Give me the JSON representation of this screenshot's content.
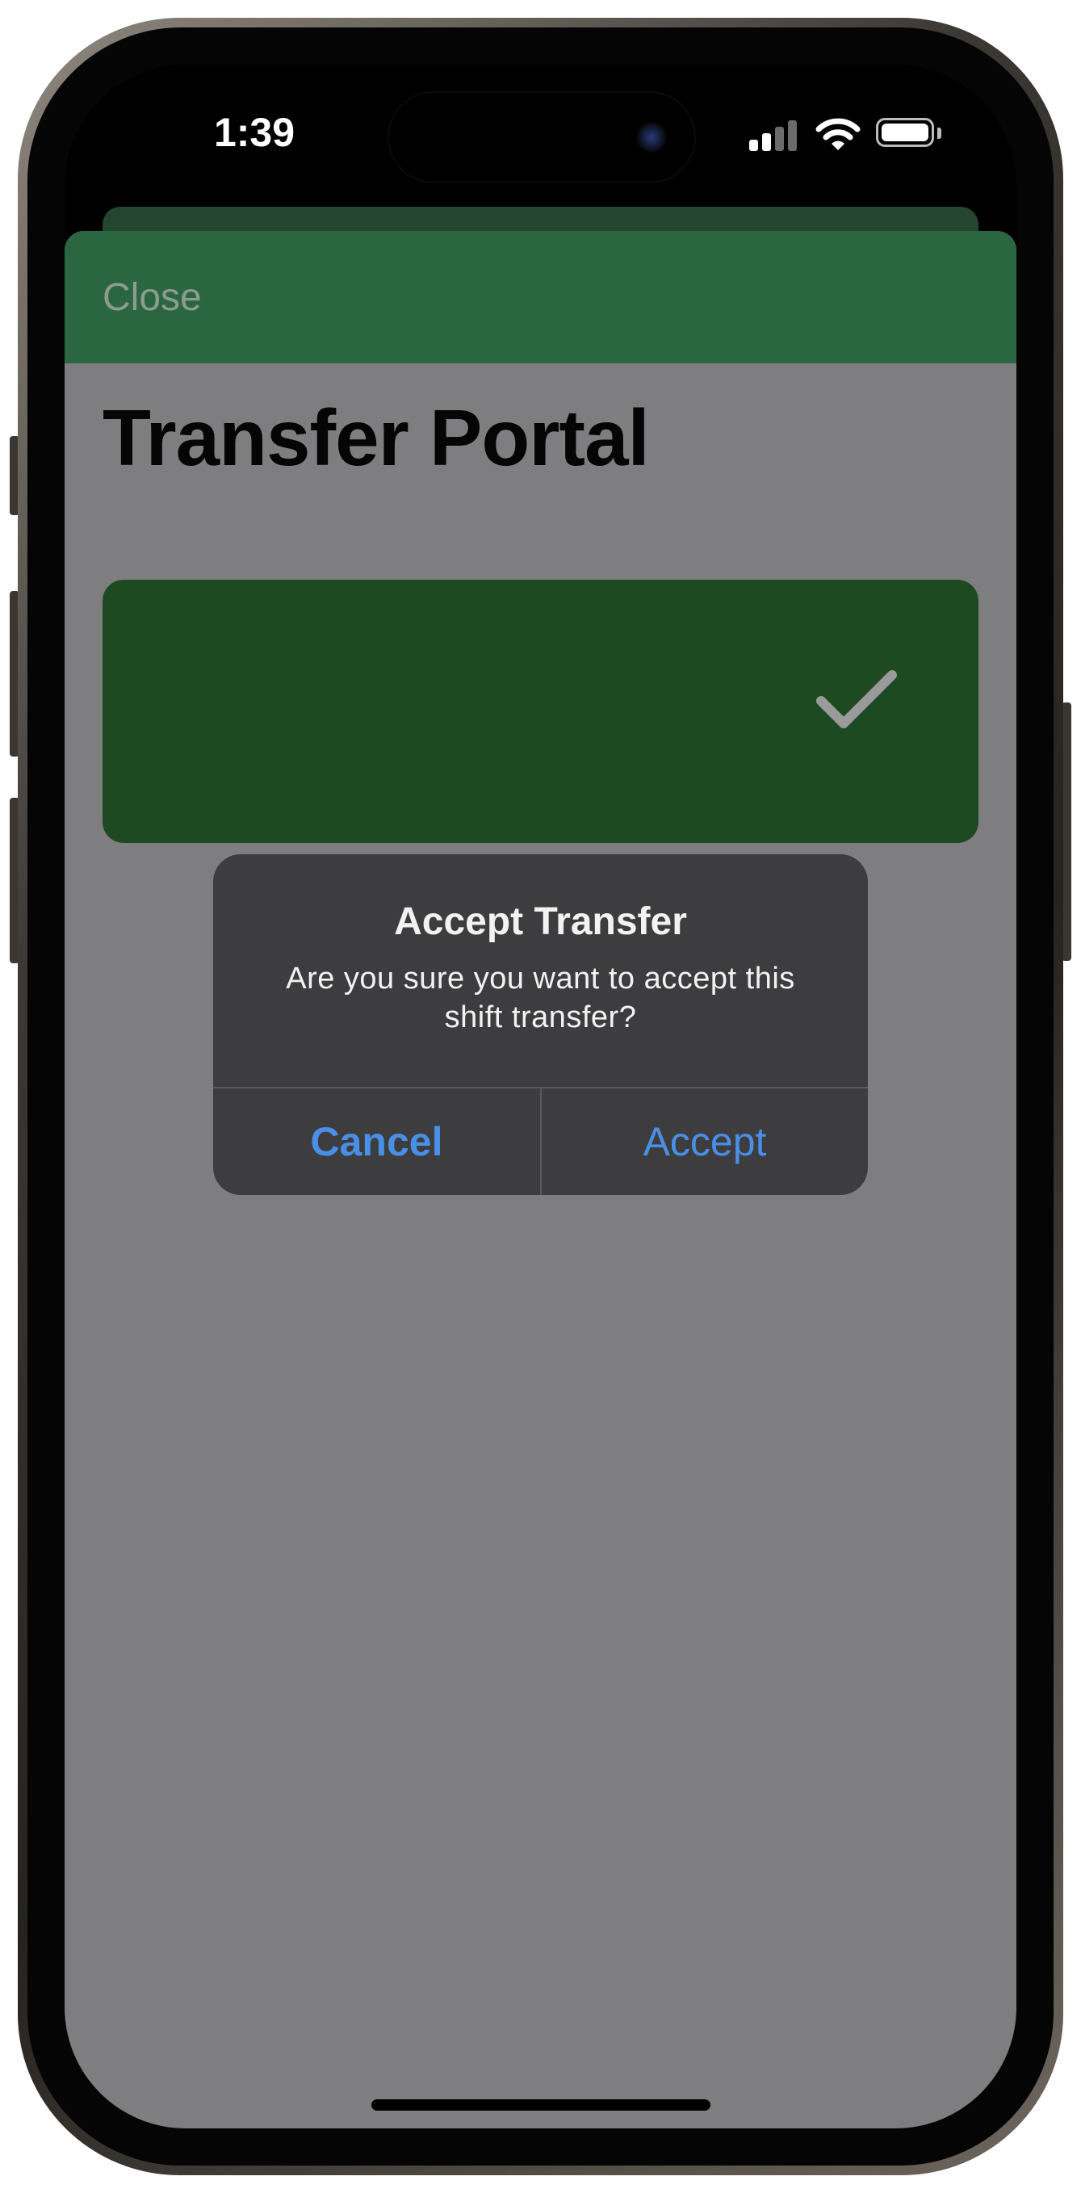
{
  "status_bar": {
    "time": "1:39",
    "signal_icon": "cellular-signal-icon",
    "wifi_icon": "wifi-icon",
    "battery_icon": "battery-icon"
  },
  "nav": {
    "close_label": "Close",
    "color": "#2a6740"
  },
  "page": {
    "title": "Transfer Portal"
  },
  "transfer_card": {
    "color": "#1e4a22",
    "status_icon": "checkmark-icon"
  },
  "alert": {
    "title": "Accept Transfer",
    "message": "Are you sure you want to accept this shift transfer?",
    "cancel_label": "Cancel",
    "accept_label": "Accept",
    "button_color": "#4a8fe6"
  }
}
